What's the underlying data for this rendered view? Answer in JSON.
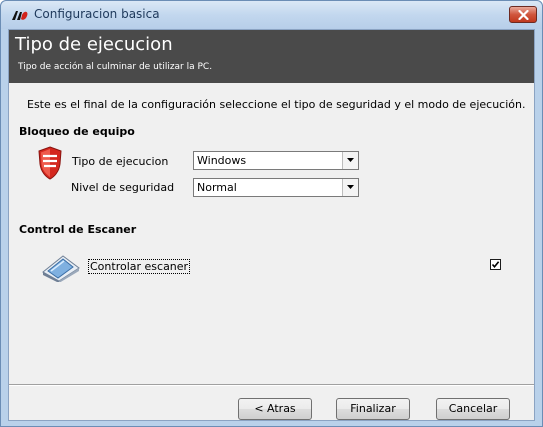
{
  "window": {
    "title": "Configuracion basica",
    "close_icon": "close-icon",
    "app_icon": "app-logo-icon"
  },
  "banner": {
    "title": "Tipo de ejecucion",
    "subtitle": "Tipo de acción al culminar de utilizar la PC."
  },
  "intro_text": "Este es el final de la configuración seleccione el tipo de seguridad y el modo de ejecución.",
  "lock_section": {
    "title": "Bloqueo de equipo",
    "icon": "shield-icon",
    "execution_type": {
      "label": "Tipo de ejecucion",
      "value": "Windows"
    },
    "security_level": {
      "label": "Nivel de seguridad",
      "value": "Normal"
    }
  },
  "scanner_section": {
    "title": "Control de Escaner",
    "icon": "scanner-icon",
    "checkbox_label": "Controlar escaner",
    "checked": true
  },
  "buttons": {
    "back": "< Atras",
    "finish": "Finalizar",
    "cancel": "Cancelar"
  },
  "colors": {
    "banner_bg": "#4a4a4a",
    "shield_red": "#d4271e",
    "close_red": "#c9482f"
  }
}
